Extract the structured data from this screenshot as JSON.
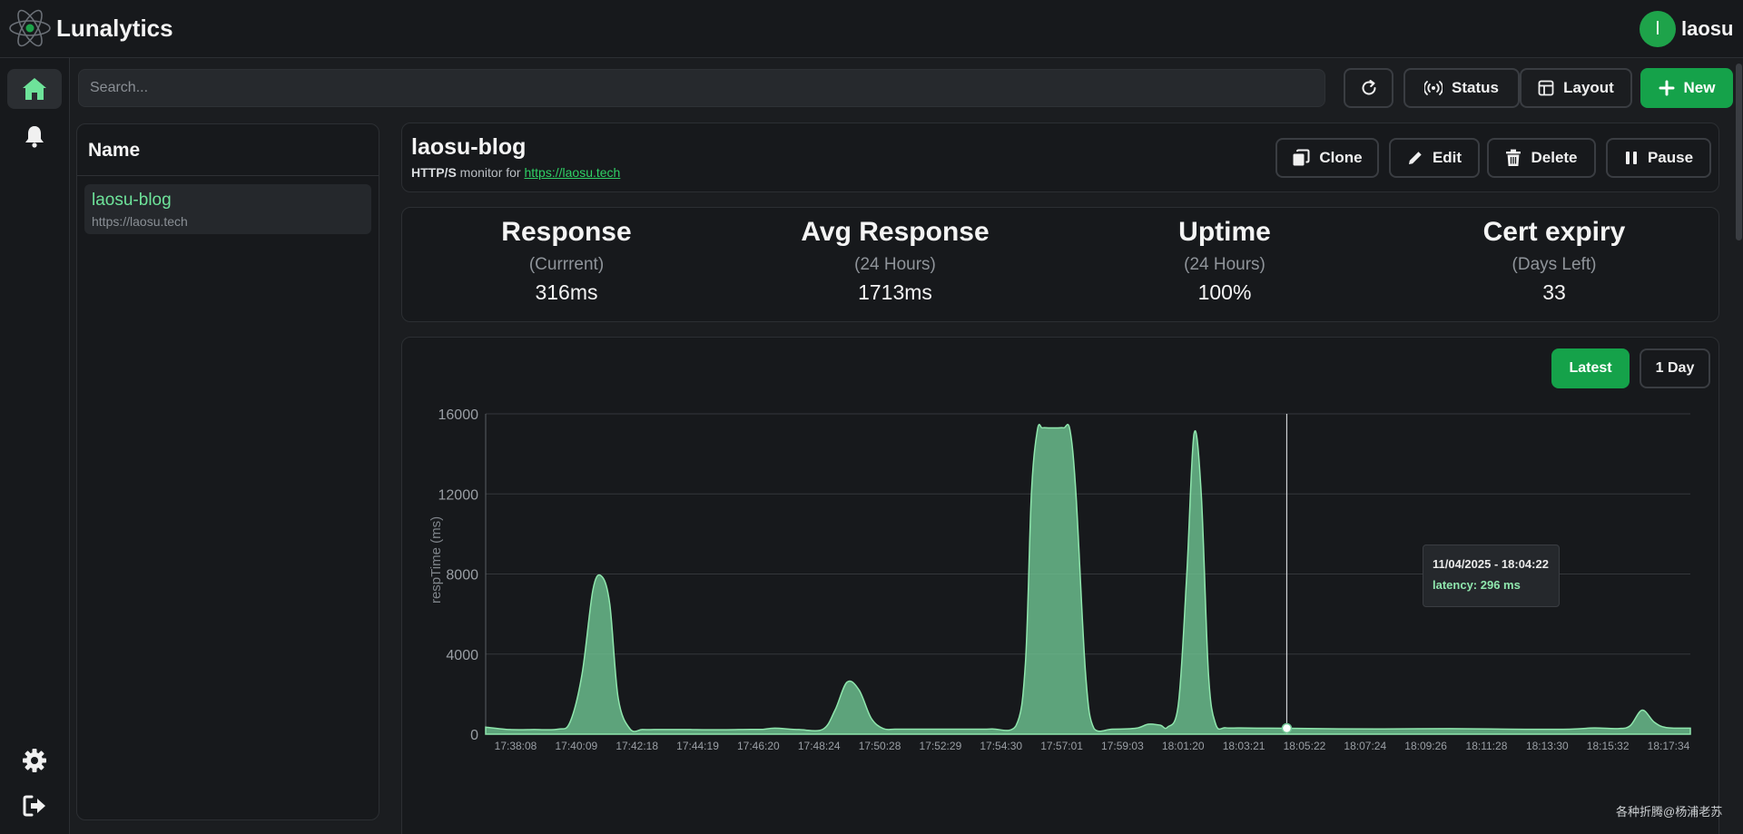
{
  "app": {
    "brand": "Lunalytics",
    "user_initial": "l",
    "username": "laosu"
  },
  "colors": {
    "accent": "#15a24a",
    "accent_text": "#6ee39a",
    "series": "#6fc593"
  },
  "nav": {
    "items": [
      {
        "name": "home",
        "icon": "home-icon",
        "active": true
      },
      {
        "name": "notifications",
        "icon": "bell-icon"
      },
      {
        "name": "settings",
        "icon": "gear-icon"
      },
      {
        "name": "sign-out",
        "icon": "sign-out-icon"
      }
    ]
  },
  "search": {
    "placeholder": "Search..."
  },
  "toolbar": {
    "refresh_icon": "refresh-icon",
    "status_label": "Status",
    "layout_label": "Layout",
    "new_label": "New"
  },
  "list": {
    "header": "Name",
    "items": [
      {
        "name": "laosu-blog",
        "url": "https://laosu.tech"
      }
    ]
  },
  "monitor": {
    "name": "laosu-blog",
    "type": "HTTP/S",
    "monitor_for": "monitor for",
    "url": "https://laosu.tech",
    "actions": {
      "clone": "Clone",
      "edit": "Edit",
      "delete": "Delete",
      "pause": "Pause"
    }
  },
  "stats": [
    {
      "title": "Response",
      "sub": "(Currrent)",
      "value": "316ms"
    },
    {
      "title": "Avg Response",
      "sub": "(24 Hours)",
      "value": "1713ms"
    },
    {
      "title": "Uptime",
      "sub": "(24 Hours)",
      "value": "100%"
    },
    {
      "title": "Cert expiry",
      "sub": "(Days Left)",
      "value": "33"
    }
  ],
  "range": {
    "latest": "Latest",
    "day": "1 Day"
  },
  "tooltip": {
    "date": "11/04/2025 - 18:04:22",
    "latency": "latency: 296 ms"
  },
  "watermark": "各种折腾@杨浦老苏",
  "chart_data": {
    "type": "area",
    "ylabel": "respTime (ms)",
    "ylim": [
      0,
      16000
    ],
    "yticks": [
      0,
      4000,
      8000,
      12000,
      16000
    ],
    "ytick_labels": [
      "0",
      "4000",
      "8000",
      "12000",
      "16000"
    ],
    "xtick_labels": [
      "17:38:08",
      "17:40:09",
      "17:42:18",
      "17:44:19",
      "17:46:20",
      "17:48:24",
      "17:50:28",
      "17:52:29",
      "17:54:30",
      "17:57:01",
      "17:59:03",
      "18:01:20",
      "18:03:21",
      "18:05:22",
      "18:07:24",
      "18:09:26",
      "18:11:28",
      "18:13:30",
      "18:15:32",
      "18:17:34"
    ],
    "xrange": [
      0,
      100
    ],
    "grid": true,
    "highlight_x": 66.5,
    "x": [
      0,
      2,
      4,
      6,
      7,
      8,
      8.9,
      9.6,
      10.3,
      11,
      12,
      13,
      14,
      15,
      16,
      17,
      18,
      19,
      20,
      21,
      22,
      23,
      24,
      26,
      28,
      29,
      30,
      31,
      32,
      33,
      34,
      36,
      38,
      40,
      42,
      44,
      44.8,
      45.3,
      45.8,
      46.2,
      46.7,
      47,
      47.5,
      48,
      48.5,
      49,
      49.8,
      50.5,
      52,
      54,
      55,
      56,
      56.6,
      57.5,
      58.2,
      58.8,
      59.4,
      60,
      60.6,
      61.4,
      62.5,
      64,
      66.5,
      70,
      74,
      80,
      85,
      90,
      92,
      94,
      95,
      96,
      97,
      98,
      100
    ],
    "y": [
      350,
      230,
      230,
      250,
      600,
      3000,
      7200,
      7900,
      6500,
      1800,
      250,
      230,
      230,
      230,
      230,
      230,
      220,
      220,
      220,
      230,
      240,
      240,
      300,
      230,
      250,
      1200,
      2600,
      2200,
      800,
      280,
      250,
      250,
      250,
      250,
      260,
      400,
      3500,
      12000,
      15200,
      15300,
      15300,
      15300,
      15300,
      15300,
      15200,
      12000,
      3000,
      280,
      250,
      300,
      500,
      450,
      350,
      1500,
      8000,
      15000,
      12000,
      3000,
      500,
      320,
      310,
      300,
      296,
      270,
      260,
      280,
      250,
      250,
      310,
      280,
      420,
      1200,
      600,
      330,
      300
    ]
  }
}
